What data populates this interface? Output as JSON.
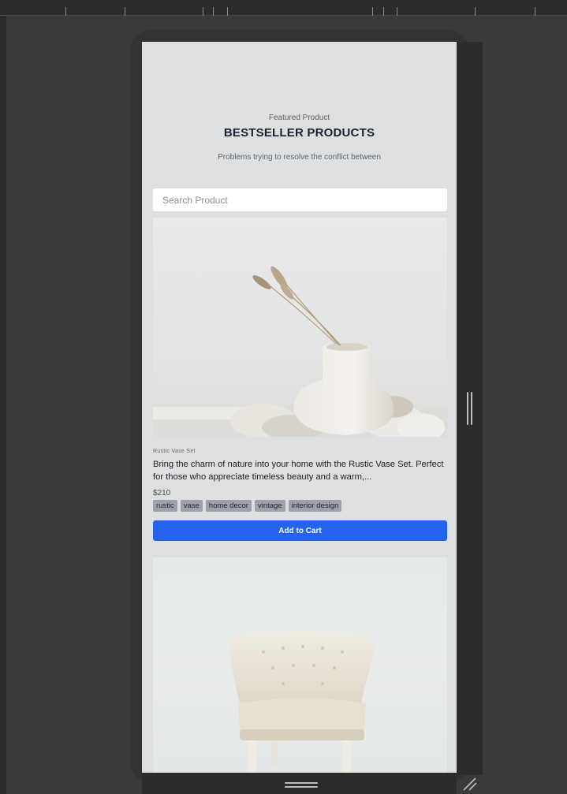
{
  "section": {
    "kicker": "Featured Product",
    "title": "BESTSELLER PRODUCTS",
    "subtitle": "Problems trying to resolve the conflict between"
  },
  "search": {
    "placeholder": "Search Product",
    "value": ""
  },
  "products": [
    {
      "category": "Rustic Vase Set",
      "description": "Bring the charm of nature into your home with the Rustic Vase Set. Perfect for those who appreciate timeless beauty and a warm,...",
      "price": "$210",
      "tags": [
        "rustic",
        "vase",
        "home decor",
        "vintage",
        "interior design"
      ],
      "cta": "Add to Cart",
      "image": "white-vase-with-dried-grass"
    },
    {
      "image": "white-tufted-armchair"
    }
  ],
  "colors": {
    "screen_bg": "#dedfe1",
    "primary": "#2563eb",
    "tag_bg": "#9ca1ab",
    "canvas_bg": "#3a3a3a"
  },
  "icons": [
    "resize-handle-vertical-icon",
    "resize-handle-horizontal-icon",
    "resize-corner-icon"
  ]
}
